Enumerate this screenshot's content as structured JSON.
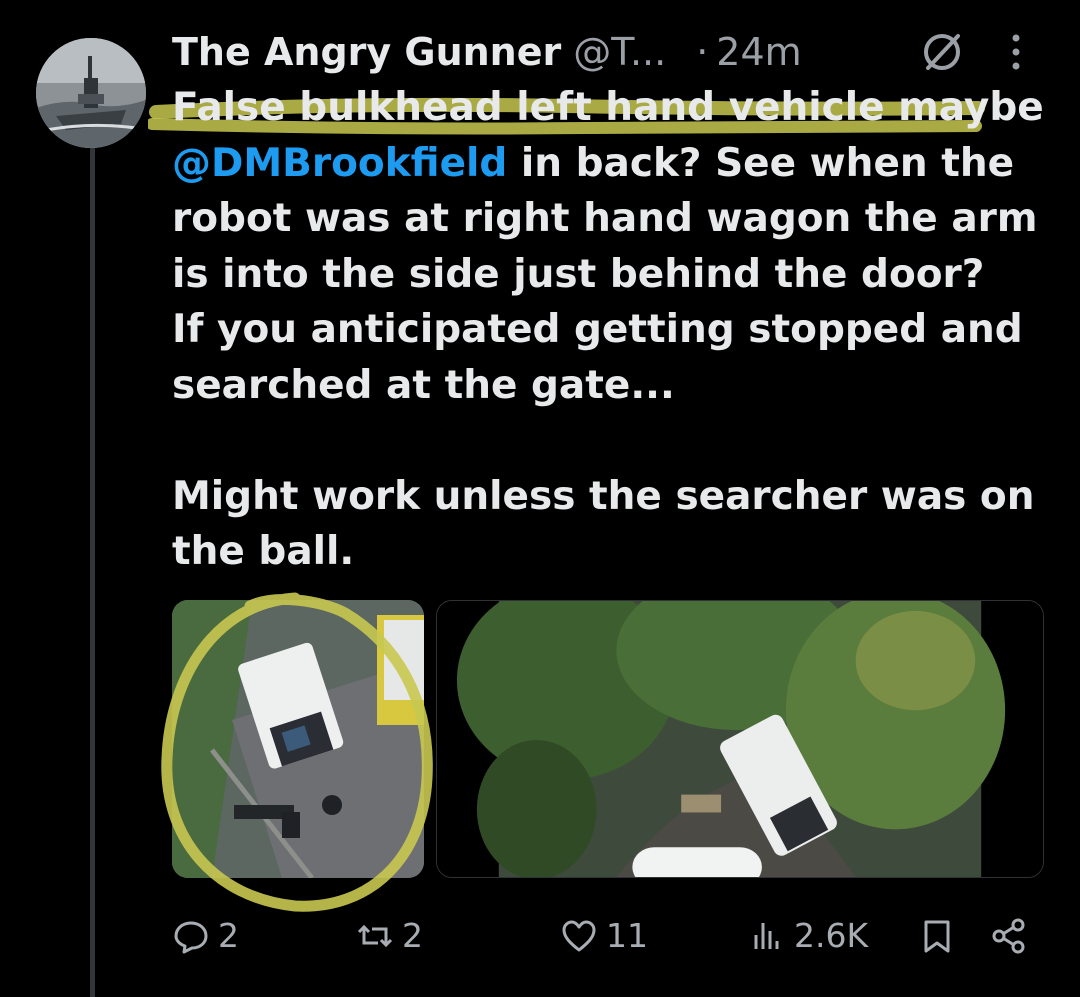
{
  "colors": {
    "background": "#000000",
    "text": "#e7e9ea",
    "muted": "#9aa0a6",
    "mention": "#1d9bf0",
    "annotation": "#c8c850"
  },
  "author": {
    "display_name": "The Angry Gunner",
    "handle": "@T...",
    "separator": "·",
    "time": "24m",
    "avatar_icon": "warship-avatar"
  },
  "tweet": {
    "line_1": "False bulkhead left hand vehicle maybe",
    "mention": "@DMBrookfield",
    "line_2_rest": " in back? See when the",
    "line_3": "robot was at right hand wagon the arm",
    "line_4": "is into the side just behind the door?",
    "line_5": "If you anticipated getting stopped and",
    "line_6": "searched at the gate...",
    "line_7": "",
    "line_8": "Might work unless the searcher was on",
    "line_9": "the ball."
  },
  "media": [
    {
      "icon": "aerial-photo-white-van-open-doors"
    },
    {
      "icon": "aerial-photo-vans-under-trees-robot"
    }
  ],
  "actions": {
    "replies": "2",
    "reposts": "2",
    "likes": "11",
    "views": "2.6K",
    "reply_icon": "speech-bubble-icon",
    "repost_icon": "repost-arrows-icon",
    "like_icon": "heart-icon",
    "views_icon": "bar-chart-icon",
    "bookmark_icon": "bookmark-icon",
    "share_icon": "share-icon"
  }
}
